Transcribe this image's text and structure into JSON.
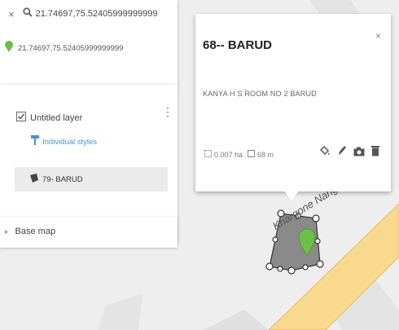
{
  "search": {
    "query": "21.74697,75.52405999999999",
    "result_coords": "21.74697,75.52405999999999"
  },
  "layer": {
    "name": "Untitled layer",
    "style_label": "Individual styles",
    "feature_label": "79- BARUD"
  },
  "basemap": {
    "label": "Base map"
  },
  "popup": {
    "title": "68-- BARUD",
    "description": "KANYA H S ROOM NO 2 BARUD",
    "area": "0.007 ha",
    "perimeter": "68 m"
  },
  "map": {
    "road_label": "Khargone Nangalwadi Ro"
  },
  "colors": {
    "marker_green": "#6cc04a",
    "road_fill": "#f8d98d",
    "road_edge": "#e4bd62",
    "polygon_fill": "#8a8a8a",
    "layer_style_blue": "#4a90d9"
  },
  "icons": {
    "search": "search-icon",
    "close": "close-icon",
    "place_marker": "place-marker-icon",
    "checkbox": "checkbox-checked-icon",
    "menu": "more-vertical-icon",
    "paint_bucket": "paint-bucket-icon",
    "edit": "pencil-icon",
    "camera": "camera-icon",
    "delete": "trash-icon"
  }
}
